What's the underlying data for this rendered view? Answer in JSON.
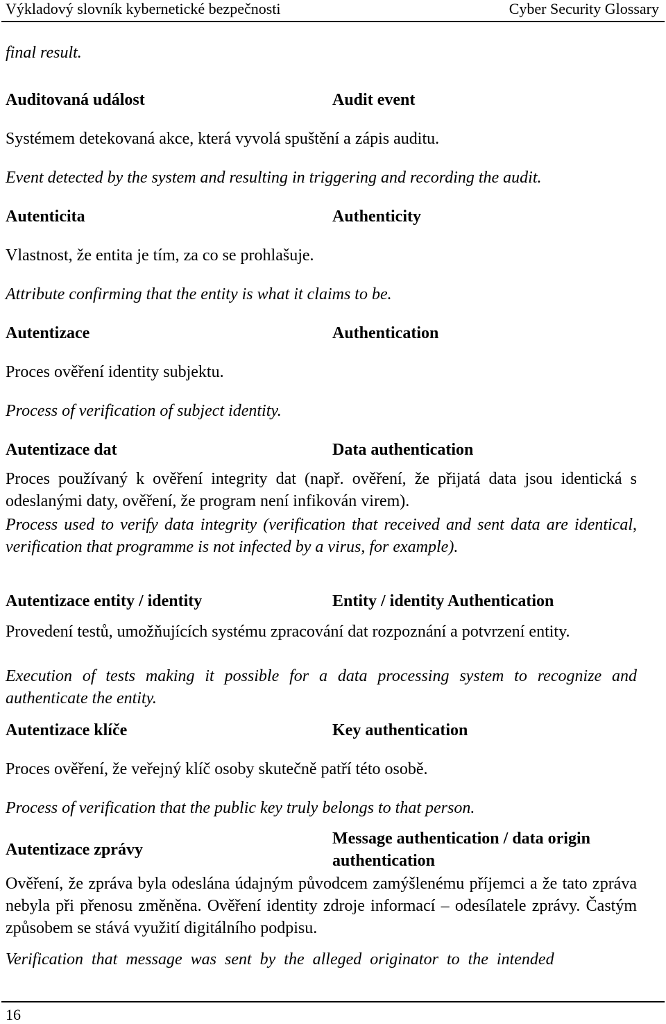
{
  "header": {
    "left_title": "Výkladový slovník kybernetické bezpečnosti",
    "right_title": "Cyber Security Glossary"
  },
  "continuation_text": "final result.",
  "entries": [
    {
      "term_cz": "Auditovaná událost",
      "term_en": "Audit event",
      "def_cz": "Systémem detekovaná akce, která vyvolá spuštění a zápis auditu.",
      "def_en": "Event detected by the system and resulting in triggering and recording the audit."
    },
    {
      "term_cz": "Autenticita",
      "term_en": "Authenticity",
      "def_cz": "Vlastnost, že entita je tím, za co se prohlašuje.",
      "def_en": "Attribute confirming that the entity is what it claims to be."
    },
    {
      "term_cz": "Autentizace",
      "term_en": "Authentication",
      "def_cz": "Proces ověření identity subjektu.",
      "def_en": "Process of verification of subject identity."
    },
    {
      "term_cz": "Autentizace dat",
      "term_en": "Data authentication",
      "def_cz": "Proces používaný k ověření integrity dat (např. ověření, že přijatá data jsou identická s odeslanými daty, ověření, že program není infikován virem).",
      "def_en": "Process used to verify data integrity (verification that received and sent data are identical, verification that programme is not infected by a virus, for example)."
    },
    {
      "term_cz": "Autentizace entity / identity",
      "term_en": "Entity / identity Authentication",
      "def_cz": "Provedení testů, umožňujících systému zpracování dat rozpoznání a potvrzení entity.",
      "def_en": "Execution of tests making it possible for a data processing system to recognize and authenticate the entity."
    },
    {
      "term_cz": "Autentizace klíče",
      "term_en": "Key authentication",
      "def_cz": "Proces ověření, že veřejný klíč osoby skutečně patří této osobě.",
      "def_en": "Process of verification that the public key truly belongs to that person."
    },
    {
      "term_cz": "Autentizace zprávy",
      "term_en_line1": "Message authentication / data origin",
      "term_en_line2": "authentication",
      "def_cz": "Ověření, že zpráva byla odeslána údajným původcem zamýšlenému příjemci a že tato zpráva nebyla při přenosu změněna. Ověření identity zdroje informací – odesílatele zprávy. Častým způsobem se stává využití digitálního podpisu.",
      "def_en": "Verification that message was sent by the alleged originator to the intended"
    }
  ],
  "footer": {
    "page_number": "16"
  }
}
